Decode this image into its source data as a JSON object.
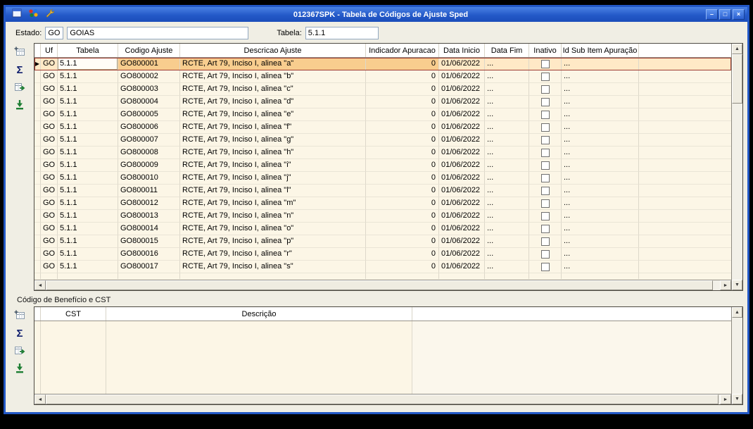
{
  "window": {
    "title": "012367SPK - Tabela de Códigos de Ajuste Sped",
    "controls": {
      "minimize": "–",
      "maximize": "□",
      "close": "×"
    }
  },
  "icons": {
    "sigma": "Σ",
    "up": "▲",
    "down": "▼",
    "left": "◄",
    "right": "►",
    "row_indicator": "▶"
  },
  "form": {
    "estado_label": "Estado:",
    "estado_uf": "GO",
    "estado_nome": "GOIAS",
    "tabela_label": "Tabela:",
    "tabela_value": "5.1.1"
  },
  "main_grid": {
    "columns": [
      "Uf",
      "Tabela",
      "Codigo Ajuste",
      "Descricao Ajuste",
      "Indicador Apuracao",
      "Data Inicio",
      "Data Fim",
      "Inativo",
      "Id Sub Item Apuração"
    ],
    "selected_row_index": 0,
    "rows": [
      {
        "uf": "GO",
        "tabela": "5.1.1",
        "codigo": "GO800001",
        "descricao": "RCTE, Art 79, Inciso I, alinea \"a\"",
        "indicador_apuracao": "0",
        "data_inicio": "01/06/2022",
        "data_fim": "...",
        "inativo": false,
        "id_sub_item": "..."
      },
      {
        "uf": "GO",
        "tabela": "5.1.1",
        "codigo": "GO800002",
        "descricao": "RCTE, Art 79, Inciso I, alinea \"b\"",
        "indicador_apuracao": "0",
        "data_inicio": "01/06/2022",
        "data_fim": "...",
        "inativo": false,
        "id_sub_item": "..."
      },
      {
        "uf": "GO",
        "tabela": "5.1.1",
        "codigo": "GO800003",
        "descricao": "RCTE, Art 79, Inciso I, alinea \"c\"",
        "indicador_apuracao": "0",
        "data_inicio": "01/06/2022",
        "data_fim": "...",
        "inativo": false,
        "id_sub_item": "..."
      },
      {
        "uf": "GO",
        "tabela": "5.1.1",
        "codigo": "GO800004",
        "descricao": "RCTE, Art 79, Inciso I, alinea \"d\"",
        "indicador_apuracao": "0",
        "data_inicio": "01/06/2022",
        "data_fim": "...",
        "inativo": false,
        "id_sub_item": "..."
      },
      {
        "uf": "GO",
        "tabela": "5.1.1",
        "codigo": "GO800005",
        "descricao": "RCTE, Art 79, Inciso I, alinea \"e\"",
        "indicador_apuracao": "0",
        "data_inicio": "01/06/2022",
        "data_fim": "...",
        "inativo": false,
        "id_sub_item": "..."
      },
      {
        "uf": "GO",
        "tabela": "5.1.1",
        "codigo": "GO800006",
        "descricao": "RCTE, Art 79, Inciso I, alinea \"f\"",
        "indicador_apuracao": "0",
        "data_inicio": "01/06/2022",
        "data_fim": "...",
        "inativo": false,
        "id_sub_item": "..."
      },
      {
        "uf": "GO",
        "tabela": "5.1.1",
        "codigo": "GO800007",
        "descricao": "RCTE, Art 79, Inciso I, alinea \"g\"",
        "indicador_apuracao": "0",
        "data_inicio": "01/06/2022",
        "data_fim": "...",
        "inativo": false,
        "id_sub_item": "..."
      },
      {
        "uf": "GO",
        "tabela": "5.1.1",
        "codigo": "GO800008",
        "descricao": "RCTE, Art 79, Inciso I, alinea \"h\"",
        "indicador_apuracao": "0",
        "data_inicio": "01/06/2022",
        "data_fim": "...",
        "inativo": false,
        "id_sub_item": "..."
      },
      {
        "uf": "GO",
        "tabela": "5.1.1",
        "codigo": "GO800009",
        "descricao": "RCTE, Art 79, Inciso I, alinea \"i\"",
        "indicador_apuracao": "0",
        "data_inicio": "01/06/2022",
        "data_fim": "...",
        "inativo": false,
        "id_sub_item": "..."
      },
      {
        "uf": "GO",
        "tabela": "5.1.1",
        "codigo": "GO800010",
        "descricao": "RCTE, Art 79, Inciso I, alinea \"j\"",
        "indicador_apuracao": "0",
        "data_inicio": "01/06/2022",
        "data_fim": "...",
        "inativo": false,
        "id_sub_item": "..."
      },
      {
        "uf": "GO",
        "tabela": "5.1.1",
        "codigo": "GO800011",
        "descricao": "RCTE, Art 79, Inciso I, alinea \"l\"",
        "indicador_apuracao": "0",
        "data_inicio": "01/06/2022",
        "data_fim": "...",
        "inativo": false,
        "id_sub_item": "..."
      },
      {
        "uf": "GO",
        "tabela": "5.1.1",
        "codigo": "GO800012",
        "descricao": "RCTE, Art 79, Inciso I, alinea \"m\"",
        "indicador_apuracao": "0",
        "data_inicio": "01/06/2022",
        "data_fim": "...",
        "inativo": false,
        "id_sub_item": "..."
      },
      {
        "uf": "GO",
        "tabela": "5.1.1",
        "codigo": "GO800013",
        "descricao": "RCTE, Art 79, Inciso I, alinea \"n\"",
        "indicador_apuracao": "0",
        "data_inicio": "01/06/2022",
        "data_fim": "...",
        "inativo": false,
        "id_sub_item": "..."
      },
      {
        "uf": "GO",
        "tabela": "5.1.1",
        "codigo": "GO800014",
        "descricao": "RCTE, Art 79, Inciso I, alinea \"o\"",
        "indicador_apuracao": "0",
        "data_inicio": "01/06/2022",
        "data_fim": "...",
        "inativo": false,
        "id_sub_item": "..."
      },
      {
        "uf": "GO",
        "tabela": "5.1.1",
        "codigo": "GO800015",
        "descricao": "RCTE, Art 79, Inciso I, alinea \"p\"",
        "indicador_apuracao": "0",
        "data_inicio": "01/06/2022",
        "data_fim": "...",
        "inativo": false,
        "id_sub_item": "..."
      },
      {
        "uf": "GO",
        "tabela": "5.1.1",
        "codigo": "GO800016",
        "descricao": "RCTE, Art 79, Inciso I, alinea \"r\"",
        "indicador_apuracao": "0",
        "data_inicio": "01/06/2022",
        "data_fim": "...",
        "inativo": false,
        "id_sub_item": "..."
      },
      {
        "uf": "GO",
        "tabela": "5.1.1",
        "codigo": "GO800017",
        "descricao": "RCTE, Art 79, Inciso I, alinea \"s\"",
        "indicador_apuracao": "0",
        "data_inicio": "01/06/2022",
        "data_fim": "...",
        "inativo": false,
        "id_sub_item": "..."
      }
    ]
  },
  "beneficio_section": {
    "label": "Código de Benefício e CST",
    "columns": [
      "CST",
      "Descrição"
    ],
    "rows": []
  }
}
